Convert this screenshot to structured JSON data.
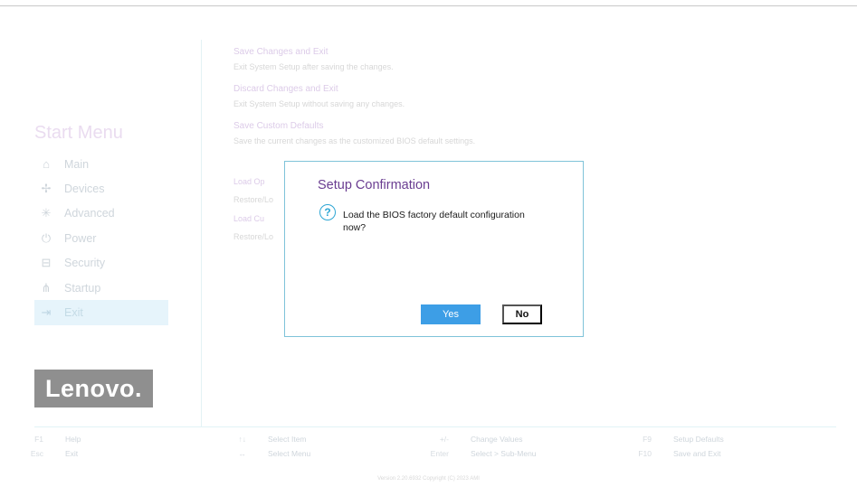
{
  "sidebar": {
    "title": "Start Menu",
    "items": [
      {
        "label": "Main",
        "icon": "home-icon"
      },
      {
        "label": "Devices",
        "icon": "devices-icon"
      },
      {
        "label": "Advanced",
        "icon": "advanced-icon"
      },
      {
        "label": "Power",
        "icon": "power-icon"
      },
      {
        "label": "Security",
        "icon": "security-icon"
      },
      {
        "label": "Startup",
        "icon": "startup-icon"
      },
      {
        "label": "Exit",
        "icon": "exit-icon",
        "active": true
      }
    ],
    "logo": "Lenovo."
  },
  "options": [
    {
      "title": "Save Changes and Exit",
      "desc": "Exit System Setup after saving the changes."
    },
    {
      "title": "Discard Changes and Exit",
      "desc": "Exit System Setup without saving any changes."
    },
    {
      "title": "Save Custom Defaults",
      "desc": "Save the current changes as the customized BIOS default settings."
    }
  ],
  "hidden_rows": {
    "row1_title": "Load Op",
    "row1_desc": "Restore/Lo",
    "row2_title": "Load Cu",
    "row2_desc": "Restore/Lo"
  },
  "dialog": {
    "title": "Setup Confirmation",
    "message": "Load the BIOS factory default configuration now?",
    "yes": "Yes",
    "no": "No"
  },
  "footer": [
    {
      "key": "F1",
      "label": "Help"
    },
    {
      "key": "Esc",
      "label": "Exit"
    },
    {
      "key": "↑↓",
      "label": "Select Item"
    },
    {
      "key": "↔",
      "label": "Select Menu"
    },
    {
      "key": "+/-",
      "label": "Change Values"
    },
    {
      "key": "Enter",
      "label": "Select > Sub-Menu"
    },
    {
      "key": "F9",
      "label": "Setup Defaults"
    },
    {
      "key": "F10",
      "label": "Save and Exit"
    }
  ],
  "version": "Version 2.20.6932 Copyright (C) 2023 AMI"
}
